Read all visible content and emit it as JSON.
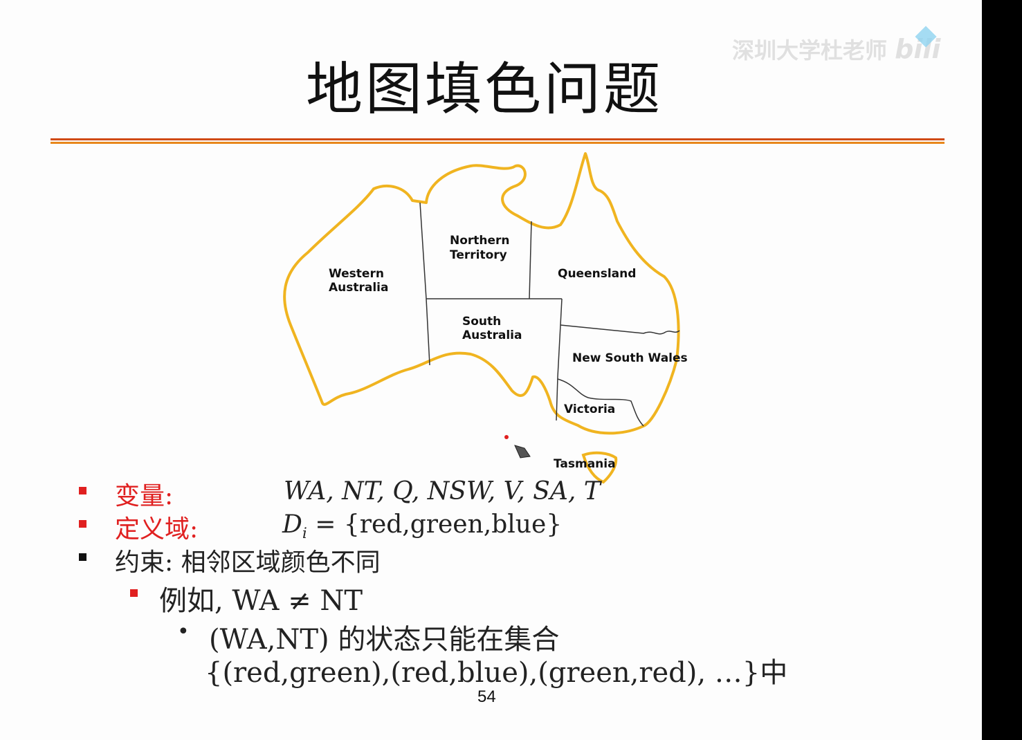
{
  "slide": {
    "title": "地图填色问题",
    "page_number": "54",
    "accent_color": "#e8871c",
    "rule_color": "#d04a16"
  },
  "watermark": {
    "text": "深圳大学杜老师",
    "logo_text": "bili"
  },
  "map": {
    "outline_color": "#f0b420",
    "regions": {
      "wa": [
        "Western",
        "Australia"
      ],
      "nt": [
        "Northern",
        "Territory"
      ],
      "q": "Queensland",
      "sa": [
        "South",
        "Australia"
      ],
      "nsw": "New South Wales",
      "v": "Victoria",
      "t": "Tasmania"
    }
  },
  "bullets": {
    "variables_label": "变量:",
    "variables_value": "WA, NT, Q, NSW, V, SA, T",
    "domain_label": "定义域:",
    "domain_var": "D",
    "domain_sub": "i",
    "domain_value": " = {red,green,blue}",
    "constraint_text": "约束: 相邻区域颜色不同",
    "example_text": "例如, WA ≠ NT",
    "detail_line1": "(WA,NT) 的状态只能在集合",
    "detail_line2": "{(red,green),(red,blue),(green,red), …}中",
    "bullet_red": "#e02020",
    "bullet_black": "#111111"
  }
}
